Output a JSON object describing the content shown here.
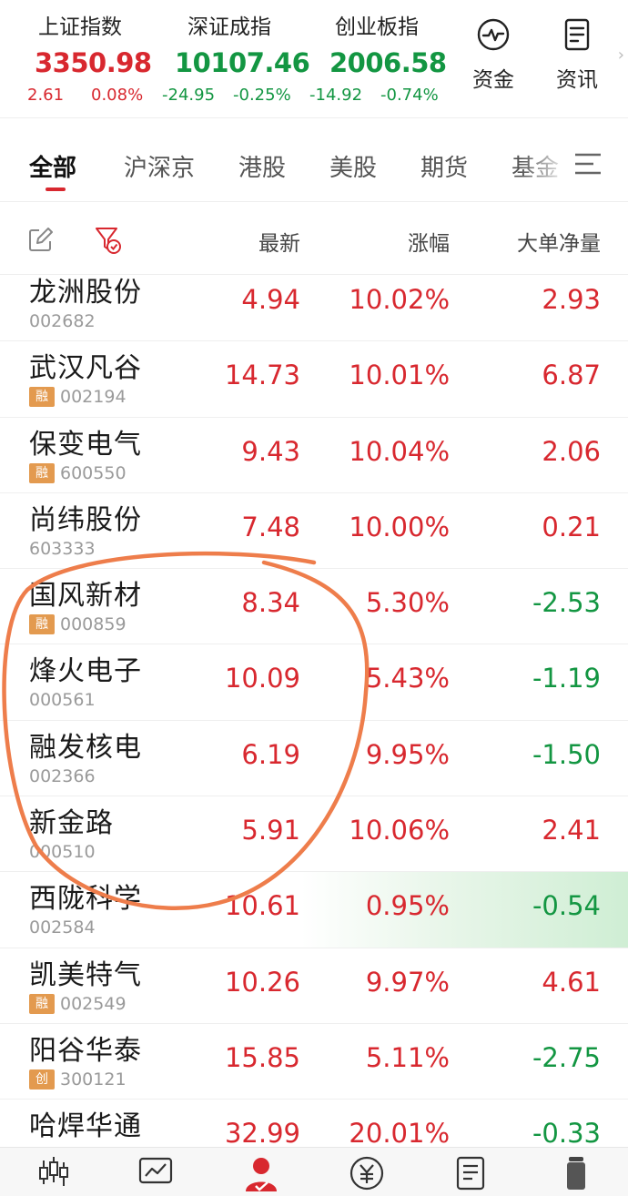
{
  "indices": [
    {
      "name": "上证指数",
      "value": "3350.98",
      "change": "2.61",
      "pct": "0.08%",
      "trend": "up"
    },
    {
      "name": "深证成指",
      "value": "10107.46",
      "change": "-24.95",
      "pct": "-0.25%",
      "trend": "down"
    },
    {
      "name": "创业板指",
      "value": "2006.58",
      "change": "-14.92",
      "pct": "-0.74%",
      "trend": "down"
    }
  ],
  "tools": [
    {
      "label": "资金",
      "icon": "pulse-icon"
    },
    {
      "label": "资讯",
      "icon": "document-icon"
    }
  ],
  "tabs": [
    "全部",
    "沪深京",
    "港股",
    "美股",
    "期货",
    "基金"
  ],
  "active_tab": "全部",
  "columns": {
    "latest": "最新",
    "change_pct": "涨幅",
    "big_order_net": "大单净量"
  },
  "colors": {
    "up": "#d8282f",
    "down": "#139642",
    "tag": "#e39a4f",
    "annotation": "#ee7d4b"
  },
  "stocks": [
    {
      "name": "龙洲股份",
      "code": "002682",
      "tag": "",
      "price": "4.94",
      "pct": "10.02%",
      "flow": "2.93",
      "flow_trend": "up"
    },
    {
      "name": "武汉凡谷",
      "code": "002194",
      "tag": "融",
      "price": "14.73",
      "pct": "10.01%",
      "flow": "6.87",
      "flow_trend": "up"
    },
    {
      "name": "保变电气",
      "code": "600550",
      "tag": "融",
      "price": "9.43",
      "pct": "10.04%",
      "flow": "2.06",
      "flow_trend": "up"
    },
    {
      "name": "尚纬股份",
      "code": "603333",
      "tag": "",
      "price": "7.48",
      "pct": "10.00%",
      "flow": "0.21",
      "flow_trend": "up"
    },
    {
      "name": "国风新材",
      "code": "000859",
      "tag": "融",
      "price": "8.34",
      "pct": "5.30%",
      "flow": "-2.53",
      "flow_trend": "down"
    },
    {
      "name": "烽火电子",
      "code": "000561",
      "tag": "",
      "price": "10.09",
      "pct": "5.43%",
      "flow": "-1.19",
      "flow_trend": "down"
    },
    {
      "name": "融发核电",
      "code": "002366",
      "tag": "",
      "price": "6.19",
      "pct": "9.95%",
      "flow": "-1.50",
      "flow_trend": "down"
    },
    {
      "name": "新金路",
      "code": "000510",
      "tag": "",
      "price": "5.91",
      "pct": "10.06%",
      "flow": "2.41",
      "flow_trend": "up"
    },
    {
      "name": "西陇科学",
      "code": "002584",
      "tag": "",
      "price": "10.61",
      "pct": "0.95%",
      "flow": "-0.54",
      "flow_trend": "down",
      "highlight": true
    },
    {
      "name": "凯美特气",
      "code": "002549",
      "tag": "融",
      "price": "10.26",
      "pct": "9.97%",
      "flow": "4.61",
      "flow_trend": "up"
    },
    {
      "name": "阳谷华泰",
      "code": "300121",
      "tag": "创",
      "price": "15.85",
      "pct": "5.11%",
      "flow": "-2.75",
      "flow_trend": "down"
    },
    {
      "name": "哈焊华通",
      "code": "",
      "tag": "",
      "price": "32.99",
      "pct": "20.01%",
      "flow": "-0.33",
      "flow_trend": "down"
    }
  ],
  "bottom_nav": [
    {
      "icon": "candlestick-icon"
    },
    {
      "icon": "chart-icon"
    },
    {
      "icon": "user-active-icon"
    },
    {
      "icon": "yuan-icon"
    },
    {
      "icon": "list-icon"
    },
    {
      "icon": "trash-icon"
    }
  ]
}
